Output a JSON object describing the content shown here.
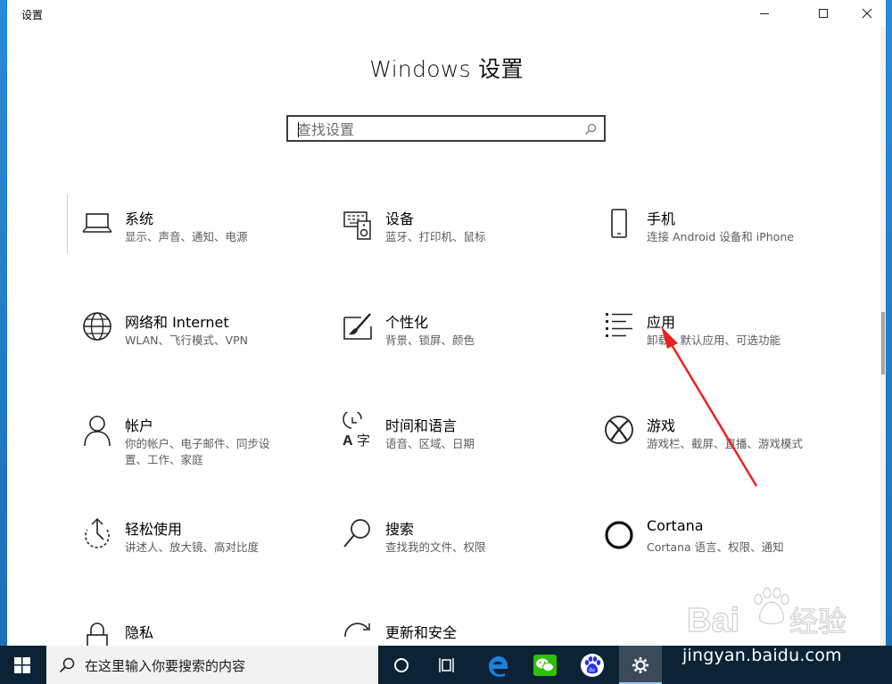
{
  "window": {
    "title": "设置",
    "controls": {
      "minimize": "minimize",
      "maximize": "maximize",
      "close": "close"
    }
  },
  "page": {
    "title": "Windows 设置"
  },
  "search": {
    "placeholder": "查找设置",
    "value": "",
    "icon": "search-icon"
  },
  "tiles": [
    {
      "icon": "laptop-icon",
      "name": "系统",
      "desc": "显示、声音、通知、电源"
    },
    {
      "icon": "keyboard-speaker-icon",
      "name": "设备",
      "desc": "蓝牙、打印机、鼠标"
    },
    {
      "icon": "phone-icon",
      "name": "手机",
      "desc": "连接 Android 设备和 iPhone"
    },
    {
      "icon": "globe-icon",
      "name": "网络和 Internet",
      "desc": "WLAN、飞行模式、VPN"
    },
    {
      "icon": "paint-brush-icon",
      "name": "个性化",
      "desc": "背景、锁屏、颜色"
    },
    {
      "icon": "apps-list-icon",
      "name": "应用",
      "desc": "卸载、默认应用、可选功能"
    },
    {
      "icon": "person-icon",
      "name": "帐户",
      "desc": "你的帐户、电子邮件、同步设置、工作、家庭"
    },
    {
      "icon": "time-language-icon",
      "name": "时间和语言",
      "desc": "语音、区域、日期"
    },
    {
      "icon": "xbox-icon",
      "name": "游戏",
      "desc": "游戏栏、截屏、直播、游戏模式"
    },
    {
      "icon": "ease-of-access-icon",
      "name": "轻松使用",
      "desc": "讲述人、放大镜、高对比度"
    },
    {
      "icon": "magnifier-icon",
      "name": "搜索",
      "desc": "查找我的文件、权限"
    },
    {
      "icon": "cortana-ring-icon",
      "name": "Cortana",
      "desc": "Cortana 语言、权限、通知"
    },
    {
      "icon": "lock-icon",
      "name": "隐私",
      "desc": ""
    },
    {
      "icon": "sync-icon",
      "name": "更新和安全",
      "desc": ""
    }
  ],
  "taskbar": {
    "search_text": "在这里输入你要搜索的内容",
    "items": [
      "windows-start-icon",
      "cortana-circle-icon",
      "task-view-icon",
      "edge-icon",
      "wechat-icon",
      "baidu-icon",
      "settings-gear-icon"
    ]
  },
  "watermark": {
    "brand": "Baidu经验",
    "url": "jingyan.baidu.com"
  },
  "colors": {
    "annotation_arrow": "#e8231f",
    "taskbar_bg": "#0c2335",
    "desktop": "#1b78c4",
    "edge_blue": "#1e7fd6",
    "wechat_green": "#2dc100",
    "baidu_blue": "#2932e1"
  }
}
